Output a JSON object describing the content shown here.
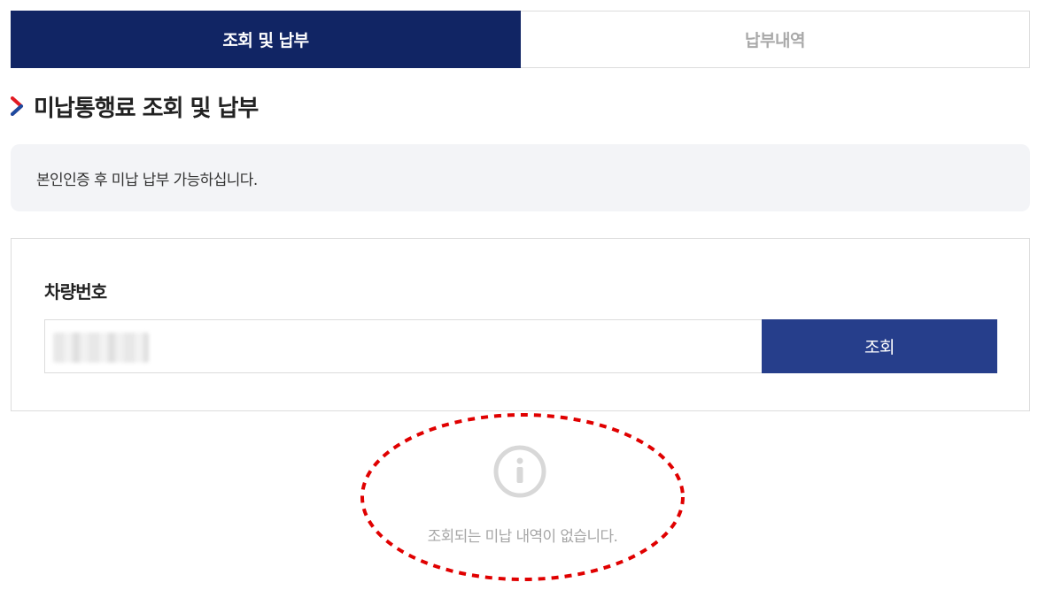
{
  "tabs": [
    {
      "label": "조회 및 납부",
      "active": true
    },
    {
      "label": "납부내역",
      "active": false
    }
  ],
  "section": {
    "title": "미납통행료 조회 및 납부"
  },
  "notice": {
    "text": "본인인증 후 미납 납부 가능하십니다."
  },
  "form": {
    "label": "차량번호",
    "plate_value": "",
    "search_button": "조회"
  },
  "empty_state": {
    "icon": "info-circle-icon",
    "message": "조회되는 미납 내역이 없습니다."
  },
  "colors": {
    "tab_active_bg": "#112564",
    "button_bg": "#263e8b",
    "highlight_oval": "#e00000",
    "chevron_red": "#e21a22",
    "chevron_blue": "#1c4ba0"
  }
}
